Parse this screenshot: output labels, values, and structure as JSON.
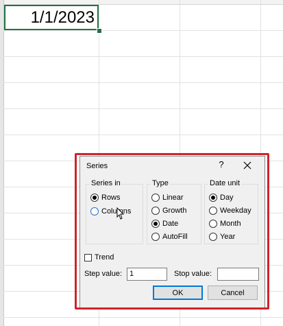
{
  "sheet": {
    "cell_a1_value": "1/1/2023"
  },
  "dialog": {
    "title": "Series",
    "help_label": "?",
    "series_in": {
      "label": "Series in",
      "options": [
        "Rows",
        "Columns"
      ],
      "selected": "Rows"
    },
    "type": {
      "label": "Type",
      "options": [
        "Linear",
        "Growth",
        "Date",
        "AutoFill"
      ],
      "selected": "Date"
    },
    "date_unit": {
      "label": "Date unit",
      "options": [
        "Day",
        "Weekday",
        "Month",
        "Year"
      ],
      "selected": "Day"
    },
    "trend_label": "Trend",
    "trend_checked": false,
    "step_value_label": "Step value:",
    "step_value": "1",
    "stop_value_label": "Stop value:",
    "stop_value": "",
    "ok_label": "OK",
    "cancel_label": "Cancel"
  },
  "colors": {
    "highlight_border": "#d0232a",
    "excel_green": "#217346",
    "default_button_border": "#0078d7"
  }
}
